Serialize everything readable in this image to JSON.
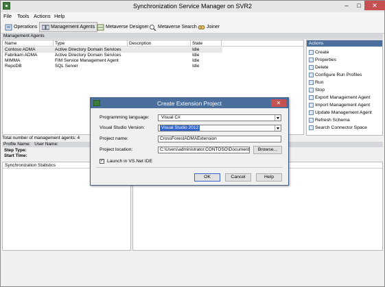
{
  "window": {
    "title": "Synchronization Service Manager on SVR2"
  },
  "window_controls": {
    "minimize": "–",
    "maximize": "□",
    "close": "✕"
  },
  "menu": [
    "File",
    "Tools",
    "Actions",
    "Help"
  ],
  "toolbar": {
    "buttons": [
      {
        "label": "Operations",
        "icon": "operations-icon"
      },
      {
        "label": "Management Agents",
        "icon": "management-agents-icon"
      },
      {
        "label": "Metaverse Designer",
        "icon": "metaverse-designer-icon"
      },
      {
        "label": "Metaverse Search",
        "icon": "metaverse-search-icon"
      },
      {
        "label": "Joiner",
        "icon": "joiner-icon"
      }
    ],
    "active": "Management Agents"
  },
  "section_title": "Management Agents",
  "grid": {
    "columns": [
      "Name",
      "Type",
      "Description",
      "State"
    ],
    "rows": [
      {
        "name": "Contoso ADMA",
        "type": "Active Directory Domain Services",
        "description": "",
        "state": "Idle",
        "selected": true
      },
      {
        "name": "Fabrikam ADMA",
        "type": "Active Directory Domain Services",
        "description": "",
        "state": "Idle",
        "selected": false
      },
      {
        "name": "MIMMA",
        "type": "FIM Service Management Agent",
        "description": "",
        "state": "Idle",
        "selected": false
      },
      {
        "name": "RepoDB",
        "type": "SQL Server",
        "description": "",
        "state": "Idle",
        "selected": false
      }
    ]
  },
  "actions": {
    "header": "Actions",
    "items": [
      "Create",
      "Properties",
      "Delete",
      "Configure Run Profiles",
      "Run",
      "Stop",
      "Export Management Agent",
      "Import Management Agent",
      "Update Management Agent",
      "Refresh Schema",
      "Search Connector Space"
    ]
  },
  "status": {
    "total": "Total number of management agents: 4",
    "profile_name": "Profile Name:",
    "user_name": "User Name:",
    "step_type": "Step Type:",
    "start_time": "Start Time:",
    "sync_stats": "Synchronization Statistics"
  },
  "dialog": {
    "title": "Create Extension Project",
    "programming_language_label": "Programming language:",
    "programming_language_value": "Visual C#",
    "vs_version_label": "Visual Studio Version:",
    "vs_version_value": "Visual Studio 2012",
    "project_name_label": "Project name:",
    "project_name_value": "CrossForestADMAExtension",
    "project_location_label": "Project location:",
    "project_location_value": "C:\\Users\\administrator.CONTOSO\\Documents",
    "browse": "Browse...",
    "launch_label": "Launch in VS.Net IDE",
    "launch_checked": true,
    "ok": "OK",
    "cancel": "Cancel",
    "help": "Help"
  }
}
